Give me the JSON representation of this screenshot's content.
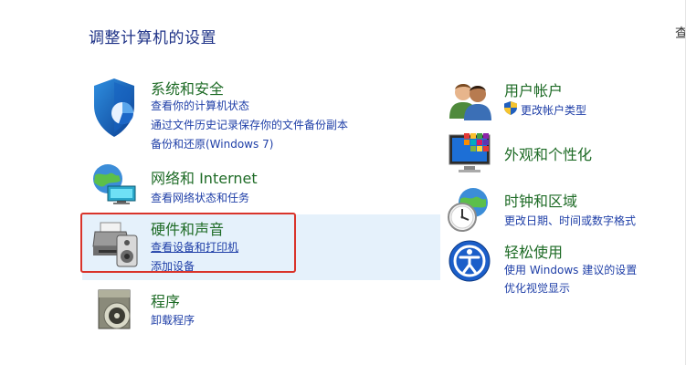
{
  "header": {
    "title": "调整计算机的设置",
    "corner_text": "查"
  },
  "left": {
    "system_security": {
      "title": "系统和安全",
      "links": [
        "查看你的计算机状态",
        "通过文件历史记录保存你的文件备份副本",
        "备份和还原(Windows 7)"
      ]
    },
    "network": {
      "title": "网络和 Internet",
      "links": [
        "查看网络状态和任务"
      ]
    },
    "hardware": {
      "title": "硬件和声音",
      "links": [
        "查看设备和打印机",
        "添加设备"
      ]
    },
    "programs": {
      "title": "程序",
      "links": [
        "卸载程序"
      ]
    }
  },
  "right": {
    "user_accounts": {
      "title": "用户帐户",
      "links": [
        "更改帐户类型"
      ]
    },
    "appearance": {
      "title": "外观和个性化"
    },
    "clock_region": {
      "title": "时钟和区域",
      "links": [
        "更改日期、时间或数字格式"
      ]
    },
    "ease_access": {
      "title": "轻松使用",
      "links": [
        "使用 Windows 建议的设置",
        "优化视觉显示"
      ]
    }
  },
  "colors": {
    "title_blue": "#1e3287",
    "category_green": "#1e6b26",
    "link_blue": "#1e3ea7",
    "highlight_bg": "#e5f1fb",
    "annotation_red": "#d9342b"
  }
}
